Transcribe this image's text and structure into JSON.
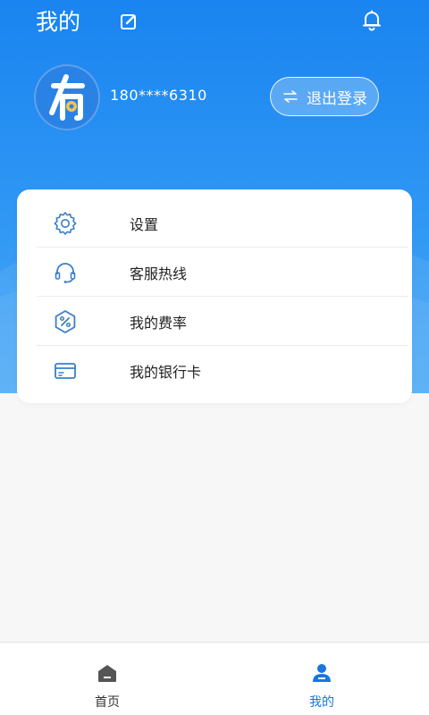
{
  "header": {
    "title": "我的"
  },
  "profile": {
    "avatar_char": "有",
    "phone": "180****6310",
    "logout_label": "退出登录"
  },
  "menu": [
    {
      "label": "设置",
      "icon": "gear-icon"
    },
    {
      "label": "客服热线",
      "icon": "headset-icon"
    },
    {
      "label": "我的费率",
      "icon": "percent-icon"
    },
    {
      "label": "我的银行卡",
      "icon": "bank-card-icon"
    }
  ],
  "tabs": [
    {
      "label": "首页",
      "icon": "home-icon",
      "active": false
    },
    {
      "label": "我的",
      "icon": "user-icon",
      "active": true
    }
  ],
  "colors": {
    "primary": "#1a84f0",
    "active_tab": "#1976e0",
    "inactive_tab": "#444444",
    "icon_blue": "#3a7fc8"
  }
}
